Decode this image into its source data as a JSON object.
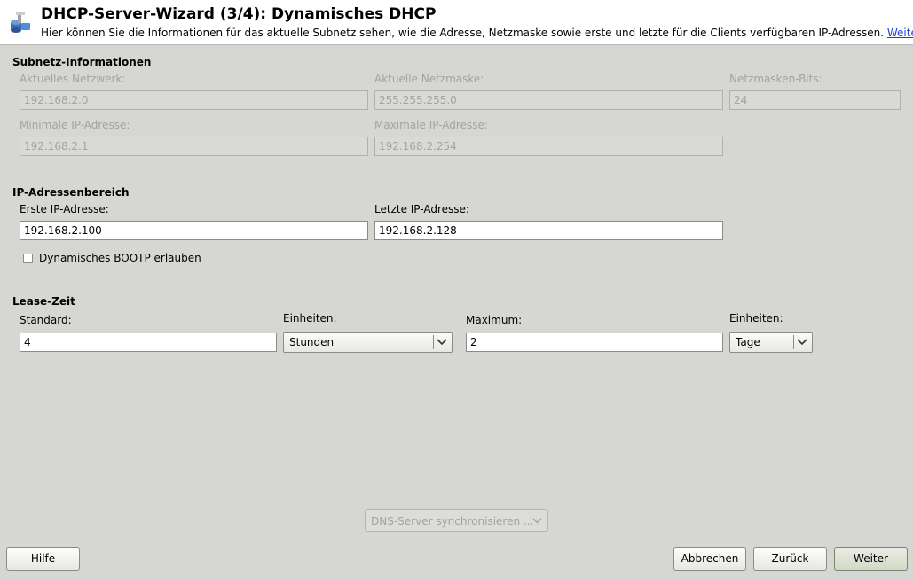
{
  "header": {
    "title": "DHCP-Server-Wizard (3/4): Dynamisches DHCP",
    "description": "Hier können Sie die Informationen für das aktuelle Subnetz sehen, wie die Adresse, Netzmaske sowie erste und letzte für die Clients verfügbaren IP-Adressen.",
    "more_link": "Weitere",
    "icon": "network-server-icon"
  },
  "subnet": {
    "title": "Subnetz-Informationen",
    "current_network_label": "Aktuelles Netzwerk:",
    "current_network_value": "192.168.2.0",
    "current_netmask_label": "Aktuelle Netzmaske:",
    "current_netmask_value": "255.255.255.0",
    "netmask_bits_label": "Netzmasken-Bits:",
    "netmask_bits_value": "24",
    "min_ip_label": "Minimale IP-Adresse:",
    "min_ip_value": "192.168.2.1",
    "max_ip_label": "Maximale IP-Adresse:",
    "max_ip_value": "192.168.2.254"
  },
  "range": {
    "title": "IP-Adressenbereich",
    "first_ip_label": "Erste IP-Adresse:",
    "first_ip_value": "192.168.2.100",
    "last_ip_label": "Letzte IP-Adresse:",
    "last_ip_value": "192.168.2.128",
    "bootp_label": "Dynamisches BOOTP erlauben",
    "bootp_checked": false
  },
  "lease": {
    "title": "Lease-Zeit",
    "standard_label": "Standard:",
    "standard_value": "4",
    "units1_label": "Einheiten:",
    "units1_value": "Stunden",
    "maximum_label": "Maximum:",
    "maximum_value": "2",
    "units2_label": "Einheiten:",
    "units2_value": "Tage"
  },
  "dns_button": "DNS-Server synchronisieren ...",
  "footer": {
    "help": "Hilfe",
    "cancel": "Abbrechen",
    "back": "Zurück",
    "next": "Weiter"
  }
}
